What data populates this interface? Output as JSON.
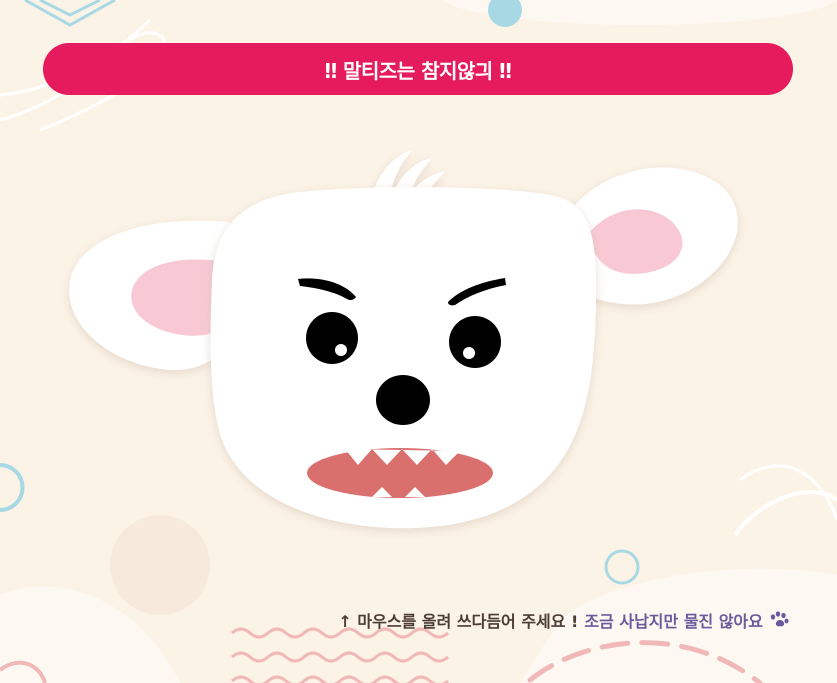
{
  "banner": {
    "text": "‼ 말티즈는 참지않긔 ‼"
  },
  "character": {
    "name": "angry-maltese",
    "colors": {
      "fur": "#ffffff",
      "ear_inner": "#f8c9d4",
      "mouth": "#d9706e",
      "eye": "#000000"
    }
  },
  "hint": {
    "main": "↑ 마우스를 올려 쓰다듬어 주세요 !",
    "sub": "조금 사납지만 물진 않아요",
    "icon": "paw-icon"
  },
  "colors": {
    "background": "#fcf3e7",
    "banner": "#e51b5d",
    "accent_blue": "#a8d8e4",
    "accent_pink": "#f0b9b7"
  }
}
